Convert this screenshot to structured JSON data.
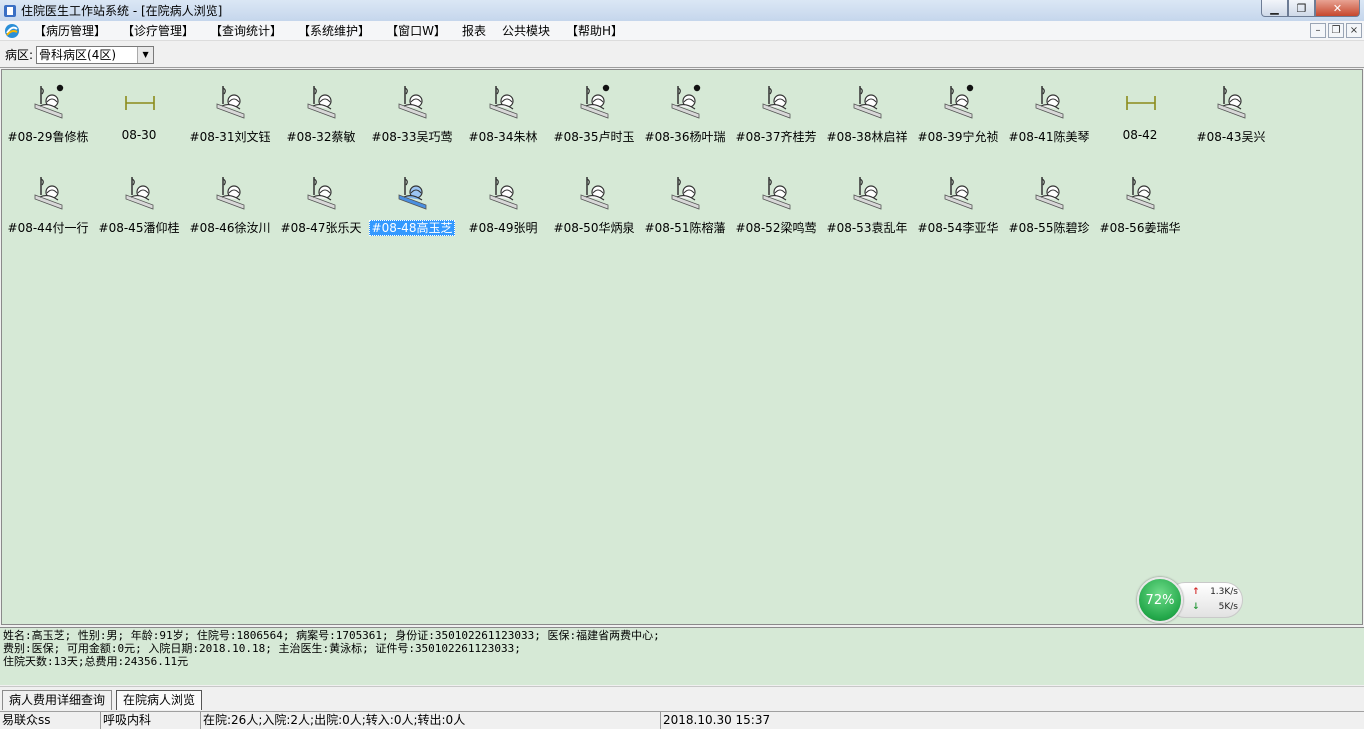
{
  "window": {
    "title": "住院医生工作站系统 - [在院病人浏览]"
  },
  "menu": {
    "items": [
      "【病历管理】",
      "【诊疗管理】",
      "【查询统计】",
      "【系统维护】",
      "【窗口W】",
      "报表",
      "公共模块",
      "【帮助H】"
    ]
  },
  "ward": {
    "label": "病区:",
    "selected": "骨科病区(4区)"
  },
  "beds": [
    {
      "label": "#08-29鲁修栋",
      "type": "patient",
      "dot": true
    },
    {
      "label": "08-30",
      "type": "empty"
    },
    {
      "label": "#08-31刘文钰",
      "type": "patient"
    },
    {
      "label": "#08-32蔡敏",
      "type": "patient"
    },
    {
      "label": "#08-33吴巧莺",
      "type": "patient"
    },
    {
      "label": "#08-34朱林",
      "type": "patient"
    },
    {
      "label": "#08-35卢时玉",
      "type": "patient",
      "dot": true
    },
    {
      "label": "#08-36杨叶瑞",
      "type": "patient",
      "dot": true
    },
    {
      "label": "#08-37齐桂芳",
      "type": "patient"
    },
    {
      "label": "#08-38林启祥",
      "type": "patient"
    },
    {
      "label": "#08-39宁允祯",
      "type": "patient",
      "dot": true
    },
    {
      "label": "#08-41陈美琴",
      "type": "patient"
    },
    {
      "label": "08-42",
      "type": "empty"
    },
    {
      "label": "#08-43吴兴",
      "type": "patient"
    },
    {
      "label": "#08-44付一行",
      "type": "patient"
    },
    {
      "label": "#08-45潘仰桂",
      "type": "patient"
    },
    {
      "label": "#08-46徐汝川",
      "type": "patient"
    },
    {
      "label": "#08-47张乐天",
      "type": "patient"
    },
    {
      "label": "#08-48高玉芝",
      "type": "patient",
      "selected": true
    },
    {
      "label": "#08-49张明",
      "type": "patient"
    },
    {
      "label": "#08-50华炳泉",
      "type": "patient"
    },
    {
      "label": "#08-51陈榕藩",
      "type": "patient"
    },
    {
      "label": "#08-52梁鸣莺",
      "type": "patient"
    },
    {
      "label": "#08-53袁乱年",
      "type": "patient"
    },
    {
      "label": "#08-54李亚华",
      "type": "patient"
    },
    {
      "label": "#08-55陈碧珍",
      "type": "patient"
    },
    {
      "label": "#08-56姜瑞华",
      "type": "patient"
    }
  ],
  "net": {
    "percent": "72%",
    "up": "1.3K/s",
    "down": "5K/s"
  },
  "info": {
    "line1": "姓名:高玉芝; 性别:男; 年龄:91岁; 住院号:1806564; 病案号:1705361; 身份证:350102261123033; 医保:福建省两费中心;",
    "line2": "费别:医保; 可用金额:0元; 入院日期:2018.10.18; 主治医生:黄泳标; 证件号:350102261123033;",
    "line3": "住院天数:13天;总费用:24356.11元"
  },
  "tabs": [
    "病人费用详细查询",
    "在院病人浏览"
  ],
  "status": {
    "user": "易联众ss",
    "dept": "呼吸内科",
    "stats": "在院:26人;入院:2人;出院:0人;转入:0人;转出:0人",
    "datetime": "2018.10.30 15:37"
  },
  "colors": {
    "panel": "#d6e9d6",
    "selection": "#3399ff",
    "empty_bed": "#8b8b1a"
  }
}
